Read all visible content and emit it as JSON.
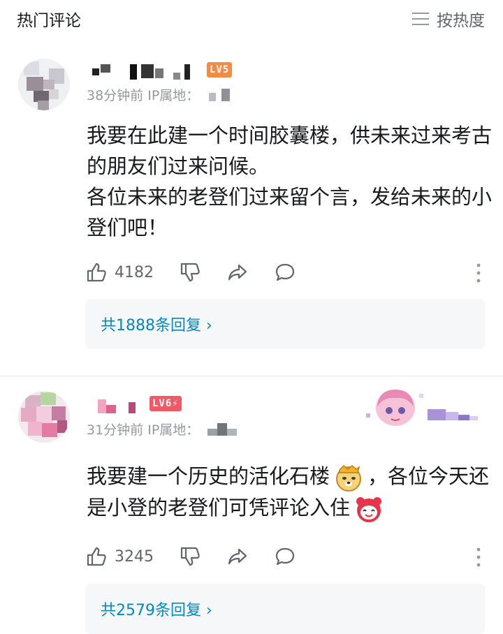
{
  "header": {
    "title": "热门评论",
    "sort_label": "按热度",
    "sort_icon": "menu-lines-icon"
  },
  "comments": [
    {
      "level_badge": "LV5",
      "level_color": "#f48b44",
      "time": "38分钟前",
      "ip_label": "IP属地：",
      "content_lines": [
        "我要在此建一个时间胶囊楼，供未来过来考古的朋友们过来问候。",
        "各位未来的老登们过来留个言，发给未来的小登们吧！"
      ],
      "likes": "4182",
      "reply_link": "共1888条回复"
    },
    {
      "level_badge": "LV6⚡",
      "level_color": "#f05a66",
      "time": "31分钟前",
      "ip_label": "IP属地：",
      "content_part1": "我要建一个历史的活化石楼",
      "content_emoji1": "doge-emoji",
      "content_part2": "，各位今天还是小登的老登们可凭评论入住",
      "content_emoji2": "red-bear-emoji",
      "likes": "3245",
      "reply_link": "共2579条回复"
    }
  ],
  "colors": {
    "link": "#008ac5",
    "secondary": "#9499a0",
    "text": "#18191c"
  }
}
